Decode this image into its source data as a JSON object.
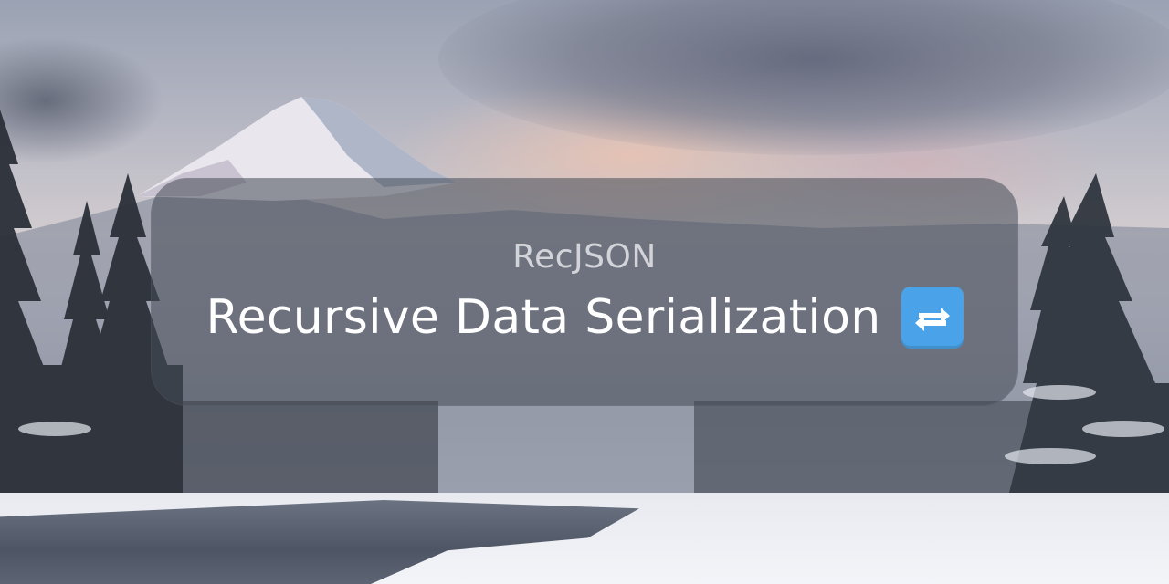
{
  "banner": {
    "project_name": "RecJSON",
    "title": "Recursive Data Serialization",
    "title_icon": "repeat-arrows-icon",
    "icon_color": "#4aa3e8"
  }
}
